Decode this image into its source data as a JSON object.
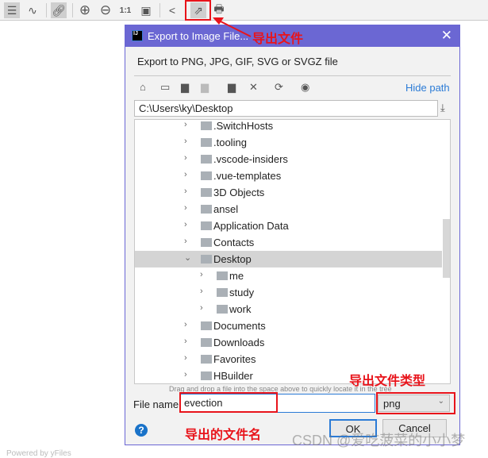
{
  "toolbar": {
    "items": [
      "settings-sliders-icon",
      "edge-route-icon",
      "link-icon",
      "zoom-in-icon",
      "zoom-out-icon",
      "actual-size-icon",
      "fit-page-icon",
      "layout-tree-icon",
      "export-icon",
      "print-icon"
    ],
    "actual_size_label": "1:1"
  },
  "dialog": {
    "title": "Export to Image File...",
    "app_icon_text": "IJ",
    "subtitle": "Export to PNG, JPG, GIF, SVG or SVGZ file",
    "hide_path": "Hide path",
    "path": "C:\\Users\\ky\\Desktop",
    "tree": [
      {
        "label": ".SwitchHosts",
        "level": 0
      },
      {
        "label": ".tooling",
        "level": 0
      },
      {
        "label": ".vscode-insiders",
        "level": 0
      },
      {
        "label": ".vue-templates",
        "level": 0
      },
      {
        "label": "3D Objects",
        "level": 0
      },
      {
        "label": "ansel",
        "level": 0
      },
      {
        "label": "Application Data",
        "level": 0
      },
      {
        "label": "Contacts",
        "level": 0
      },
      {
        "label": "Desktop",
        "level": 0,
        "expanded": true,
        "selected": true
      },
      {
        "label": "me",
        "level": 1
      },
      {
        "label": "study",
        "level": 1
      },
      {
        "label": "work",
        "level": 1
      },
      {
        "label": "Documents",
        "level": 0
      },
      {
        "label": "Downloads",
        "level": 0
      },
      {
        "label": "Favorites",
        "level": 0
      },
      {
        "label": "HBuilder",
        "level": 0
      }
    ],
    "drag_hint": "Drag and drop a file into the space above to quickly locate it in the tree",
    "file_name_label": "File name:",
    "file_name": "evection",
    "file_type": "png",
    "ok": "OK",
    "cancel": "Cancel"
  },
  "annotations": {
    "export": "导出文件",
    "file_type": "导出文件类型",
    "file_name": "导出的文件名"
  },
  "watermark": "CSDN @爱吃菠菜的小小梦",
  "footer": "Powered by yFiles",
  "colors": {
    "titlebar": "#6b67d3",
    "annotation": "#e8141b",
    "link": "#2b7bd6"
  }
}
